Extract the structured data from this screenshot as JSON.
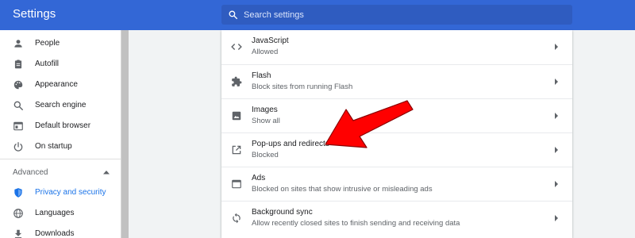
{
  "header": {
    "title": "Settings",
    "search_placeholder": "Search settings"
  },
  "sidebar": {
    "items": [
      {
        "label": "People",
        "icon": "person-icon"
      },
      {
        "label": "Autofill",
        "icon": "clipboard-icon"
      },
      {
        "label": "Appearance",
        "icon": "palette-icon"
      },
      {
        "label": "Search engine",
        "icon": "search-icon"
      },
      {
        "label": "Default browser",
        "icon": "browser-icon"
      },
      {
        "label": "On startup",
        "icon": "power-icon"
      }
    ],
    "advanced_label": "Advanced",
    "advanced_items": [
      {
        "label": "Privacy and security",
        "icon": "shield-icon",
        "active": true
      },
      {
        "label": "Languages",
        "icon": "globe-icon"
      },
      {
        "label": "Downloads",
        "icon": "download-icon"
      }
    ]
  },
  "content": {
    "rows": [
      {
        "title": "JavaScript",
        "subtitle": "Allowed",
        "icon": "code-icon"
      },
      {
        "title": "Flash",
        "subtitle": "Block sites from running Flash",
        "icon": "puzzle-icon"
      },
      {
        "title": "Images",
        "subtitle": "Show all",
        "icon": "image-icon"
      },
      {
        "title": "Pop-ups and redirects",
        "subtitle": "Blocked",
        "icon": "open-in-new-icon"
      },
      {
        "title": "Ads",
        "subtitle": "Blocked on sites that show intrusive or misleading ads",
        "icon": "ads-window-icon"
      },
      {
        "title": "Background sync",
        "subtitle": "Allow recently closed sites to finish sending and receiving data",
        "icon": "sync-icon"
      }
    ]
  },
  "colors": {
    "header": "#3367d6",
    "accent": "#1a73e8",
    "annotation_arrow": "#ff0000"
  }
}
